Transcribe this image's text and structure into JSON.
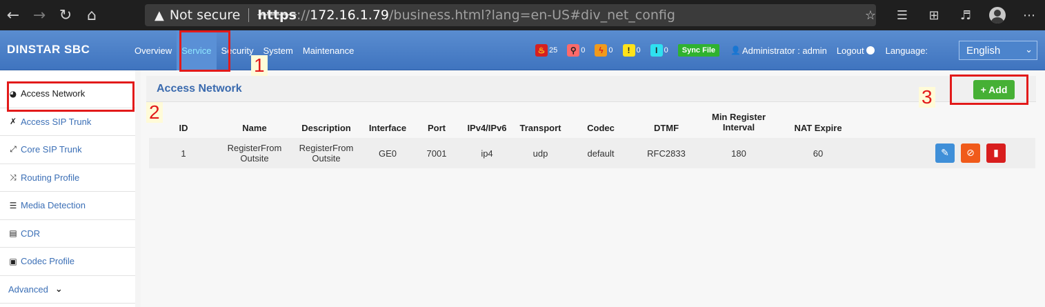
{
  "browser": {
    "not_secure": "Not secure",
    "url_scheme": "https",
    "url_sep": "://",
    "url_host": "172.16.1.79",
    "url_path": "/business.html?lang=en-US#div_net_config"
  },
  "header": {
    "brand": "DINSTAR  SBC",
    "menu": [
      {
        "label": "Overview"
      },
      {
        "label": "Service"
      },
      {
        "label": "Security"
      },
      {
        "label": "System"
      },
      {
        "label": "Maintenance"
      }
    ],
    "alarms": [
      {
        "count": "25",
        "color": "#d62020"
      },
      {
        "count": "0",
        "color": "#ff6a6a"
      },
      {
        "count": "0",
        "color": "#f09a1c"
      },
      {
        "count": "0",
        "color": "#ffe21a"
      },
      {
        "count": "0",
        "color": "#2fe0f0"
      }
    ],
    "sync_file": "Sync File",
    "admin": "Administrator : admin",
    "logout": "Logout",
    "language_label": "Language:",
    "language_value": "English"
  },
  "sidebar": {
    "items": [
      {
        "label": "Access Network"
      },
      {
        "label": "Access SIP Trunk"
      },
      {
        "label": "Core SIP Trunk"
      },
      {
        "label": "Routing Profile"
      },
      {
        "label": "Media Detection"
      },
      {
        "label": "CDR"
      },
      {
        "label": "Codec Profile"
      },
      {
        "label": "Advanced"
      }
    ]
  },
  "main": {
    "title": "Access Network",
    "add_label": "+ Add",
    "columns": [
      {
        "label": "ID"
      },
      {
        "label": "Name"
      },
      {
        "label": "Description"
      },
      {
        "label": "Interface"
      },
      {
        "label": "Port"
      },
      {
        "label": "IPv4/IPv6"
      },
      {
        "label": "Transport"
      },
      {
        "label": "Codec"
      },
      {
        "label": "DTMF"
      },
      {
        "label": "Min Register Interval"
      },
      {
        "label": "NAT Expire"
      }
    ],
    "rows": [
      {
        "id": "1",
        "name": "RegisterFrom Outsite",
        "description": "RegisterFrom Outsite",
        "interface": "GE0",
        "port": "7001",
        "ip": "ip4",
        "transport": "udp",
        "codec": "default",
        "dtmf": "RFC2833",
        "min_register": "180",
        "nat_expire": "60"
      }
    ]
  },
  "annotations": {
    "n1": "1",
    "n2": "2",
    "n3": "3"
  }
}
